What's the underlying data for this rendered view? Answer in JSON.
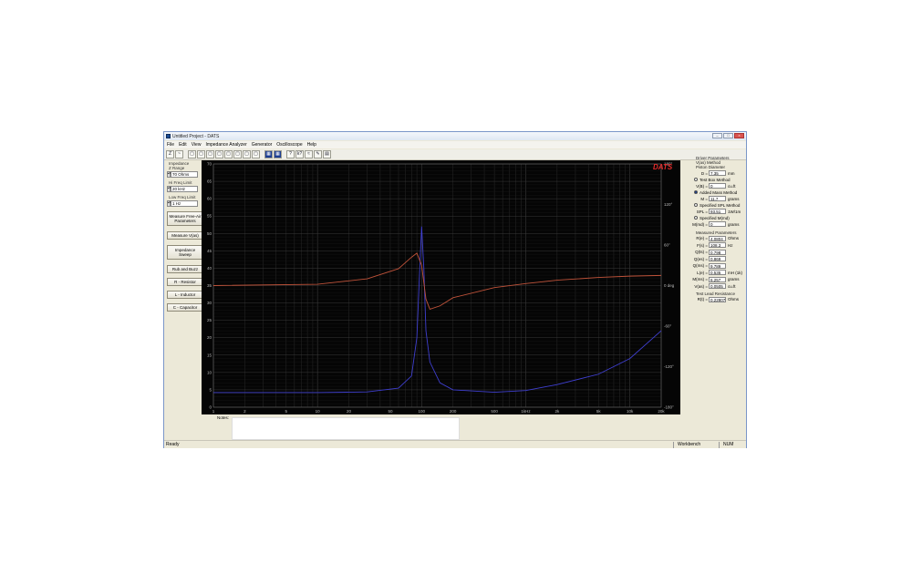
{
  "window": {
    "title": "Untitled Project - DATS"
  },
  "menu": [
    "File",
    "Edit",
    "View",
    "Impedance Analyzer",
    "Generator",
    "Oscilloscope",
    "Help"
  ],
  "toolbar": [
    "Z",
    "~",
    "▢",
    "▢",
    "▢",
    "▢",
    "▢",
    "▢",
    "▢",
    "▢",
    "▦",
    "▦",
    "?",
    "k?",
    "≈",
    "✎",
    "▤"
  ],
  "left_panel": {
    "impedance_label": "Impedance",
    "z_range_label": "Z Range",
    "z_range_value": "70 Ohms",
    "hi_freq_label": "Hi Freq Limit",
    "hi_freq_value": "20 kHz",
    "low_freq_label": "Low Freq Limit",
    "low_freq_value": "1 Hz",
    "buttons": [
      "Measure Free-Air Parameters",
      "Measure V(as)",
      "Impedance Sweep",
      "Rub and Buzz",
      "R - Resistor",
      "L - Inductor",
      "C - Capacitor"
    ]
  },
  "plot": {
    "logo": "DATS",
    "left_axis_ticks": [
      "70",
      "65",
      "60",
      "55",
      "50",
      "45",
      "40",
      "35",
      "30",
      "25",
      "20",
      "15",
      "10",
      "5",
      "0"
    ],
    "right_axis_ticks": [
      "180°",
      "120°",
      "60°",
      "0 deg",
      "-60°",
      "-120°",
      "-180°"
    ],
    "x_ticks": [
      "1",
      "2",
      "5",
      "10",
      "20",
      "50",
      "100",
      "200",
      "500",
      "1kHz",
      "2k",
      "5k",
      "10k",
      "20k"
    ],
    "colors": {
      "background": "#050505",
      "grid": "#3a3a3a",
      "impedance": "#3f3fd0",
      "phase": "#c0533a"
    }
  },
  "chart_data": {
    "type": "line",
    "x_scale": "log",
    "xlim": [
      1,
      20000
    ],
    "ylim_left": [
      0,
      70
    ],
    "ylim_right": [
      -180,
      180
    ],
    "series": [
      {
        "axis": "left",
        "x": [
          1,
          10,
          30,
          60,
          80,
          90,
          95,
          100,
          105,
          110,
          120,
          150,
          200,
          500,
          1000,
          2000,
          5000,
          10000,
          20000
        ],
        "values": [
          4.2,
          4.2,
          4.4,
          5.5,
          9,
          20,
          37,
          52,
          40,
          22,
          13,
          7,
          5,
          4.3,
          4.8,
          6.5,
          9.5,
          14,
          22
        ]
      },
      {
        "axis": "right",
        "x": [
          1,
          10,
          30,
          60,
          80,
          90,
          100,
          110,
          120,
          150,
          200,
          500,
          1000,
          2000,
          5000,
          10000,
          20000
        ],
        "values": [
          0,
          2,
          10,
          25,
          42,
          48,
          30,
          -20,
          -35,
          -30,
          -18,
          -3,
          3,
          8,
          12,
          14,
          15
        ]
      }
    ]
  },
  "right_panel": {
    "driver_params_title": "Driver Parameters",
    "vas_method_label": "V(as) Method",
    "piston_diameter_label": "Piston Diameter",
    "d_label": "D =",
    "d_value": "7.35",
    "d_unit": "mm",
    "test_box_label": "Test Box Method",
    "vb_label": "V(B) =",
    "vb_value": "0",
    "vb_unit": "cu.ft",
    "added_mass_label": "Added Mass Method",
    "m_label": "M =",
    "m_value": "11.7",
    "m_unit": "grams",
    "specified_spl_label": "Specified SPL Method",
    "spl_label": "SPL =",
    "spl_value": "93.51",
    "spl_unit": "1W/1m",
    "specified_mmd_label": "Specified M(md)",
    "mmd_label": "M(md) =",
    "mmd_value": "0",
    "mmd_unit": "grams",
    "measured_title": "Measured Parameters",
    "measured": [
      {
        "label": "R(e) =",
        "value": "4.0804",
        "unit": "Ohms"
      },
      {
        "label": "F(s) =",
        "value": "108.3",
        "unit": "Hz"
      },
      {
        "label": "Q(ts) =",
        "value": "0.798",
        "unit": ""
      },
      {
        "label": "Q(es) =",
        "value": "0.869",
        "unit": ""
      },
      {
        "label": "Q(ms) =",
        "value": "9.789",
        "unit": ""
      },
      {
        "label": "L(e) =",
        "value": "0.535",
        "unit": "mH (1k)"
      },
      {
        "label": "M(ms) =",
        "value": "6.257",
        "unit": "grams"
      },
      {
        "label": "V(as) =",
        "value": "0.0505",
        "unit": "cu.ft"
      }
    ],
    "test_lead_title": "Test Lead Resistance",
    "rt_label": "R(t) =",
    "rt_value": "0.22807",
    "rt_unit": "Ohms"
  },
  "notes_label": "Notes:",
  "status": {
    "ready": "Ready",
    "workbench": "Workbench",
    "num": "NUM"
  }
}
